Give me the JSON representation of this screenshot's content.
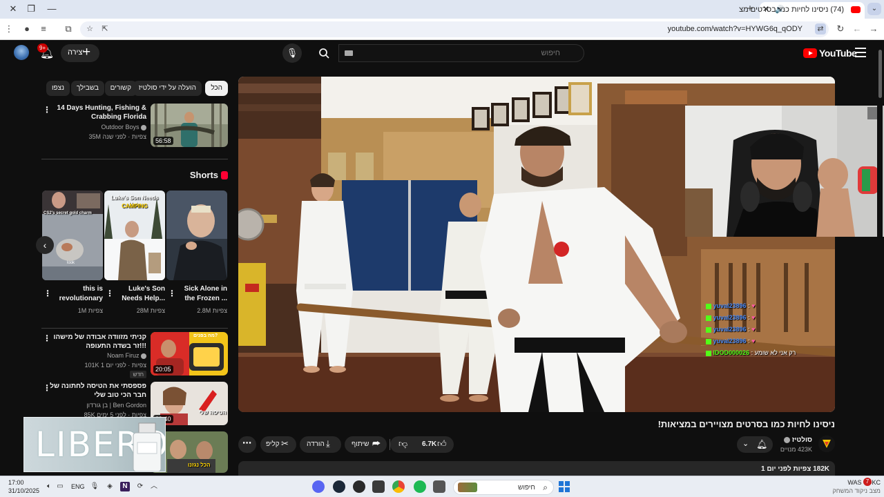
{
  "browser": {
    "tab_title": "(74) ניסינו לחיות כמו בסרטים מצ",
    "url": "youtube.com/watch?v=HYWG6q_qODY"
  },
  "header": {
    "logo_text": "YouTube",
    "search_placeholder": "חיפוש",
    "create_label": "יצירה",
    "notification_count": "9+"
  },
  "chips": [
    "הכל",
    "הועלה על ידי סולטיז",
    "קשורים",
    "בשבילך",
    "נצפו"
  ],
  "related_top": {
    "title": "14 Days Hunting, Fishing & Crabbing Florida",
    "channel": "Outdoor Boys",
    "meta": "35M צפיות · לפני שנה",
    "duration": "56:58"
  },
  "shorts": {
    "heading": "Shorts",
    "items": [
      {
        "title": "Sick Alone in the Frozen ...",
        "views": "2.8M צפיות"
      },
      {
        "title": "Luke's Son Needs Help...",
        "views": "28M צפיות"
      },
      {
        "title": "this is revolutionary",
        "views": "1M צפיות"
      }
    ],
    "thumb_texts": [
      "Luke's Son Needs Help",
      "CAMPING",
      "CS2's secret gold charm",
      "look"
    ]
  },
  "related": [
    {
      "title": "קניתי מזוודה אבודה של מישהו זר בשדה התעופה!!!",
      "channel": "Noam Firuz",
      "meta": "101K צפיות · לפני יום 1",
      "badge": "חדש",
      "duration": "20:05",
      "thumb_text": "מה בפנים?"
    },
    {
      "title": "פספסתי את הטיסה לחתונה של חבר הכי טוב שלי",
      "channel": "בן גורדון | Ben Gordon",
      "meta": "85K צפיות · לפני 5 ימים",
      "duration": "39:40",
      "thumb_text": "הטיסה שלי"
    },
    {
      "thumb_text": "הכל נגזנו"
    }
  ],
  "ad_overlay": {
    "text": "LIBERO"
  },
  "chat": [
    {
      "name": "yuval23896",
      "msg": ""
    },
    {
      "name": "yuval23896",
      "msg": ""
    },
    {
      "name": "yuval23896",
      "msg": ""
    },
    {
      "name": "yuval23896",
      "msg": ""
    },
    {
      "name": "IDOD000026",
      "msg": "רק אני לא שומע"
    }
  ],
  "video": {
    "title": "ניסינו לחיות כמו בסרטים מצויירים במציאות!",
    "channel": "סולטיז",
    "subscribers": "423K מנויים",
    "likes": "6.7K",
    "share_label": "שיתוף",
    "download_label": "הורדה",
    "clip_label": "קליפ",
    "views_date": "182K צפיות  לפני יום 1"
  },
  "taskbar": {
    "time": "17:00",
    "date": "31/10/2025",
    "lang": "ENG",
    "search_text": "חיפוש",
    "weather_title": "WAS - OKC",
    "weather_sub": "מצב ניקוד המשחק",
    "weather_badge": "7"
  }
}
